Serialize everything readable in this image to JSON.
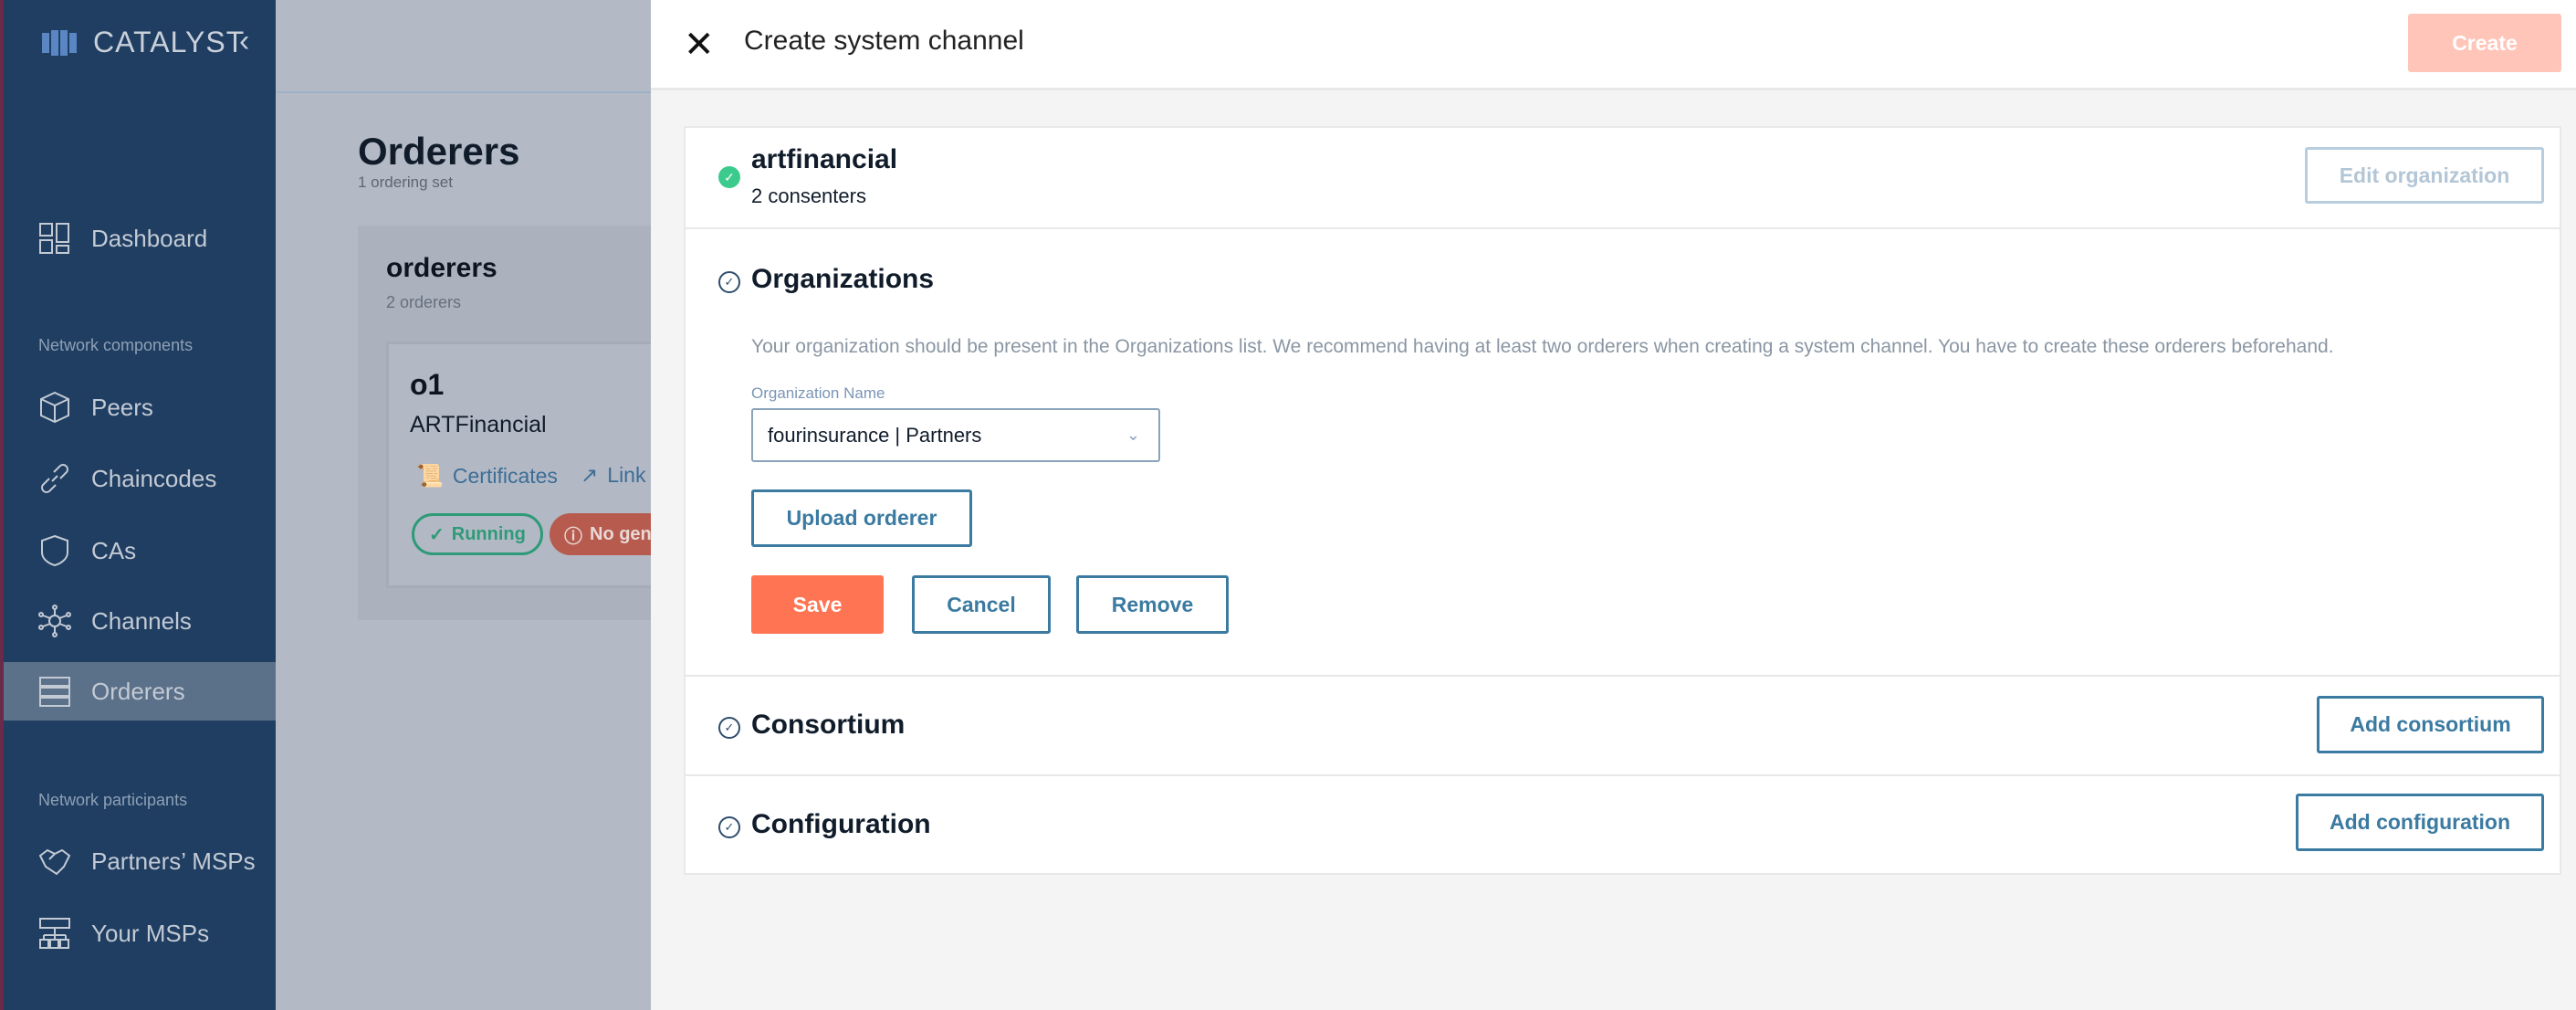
{
  "sidebar": {
    "logo": "CATALYST",
    "sections": [
      {
        "label": "Network components"
      },
      {
        "label": "Network participants"
      }
    ],
    "items": [
      {
        "label": "Dashboard",
        "icon": "dashboard-icon"
      },
      {
        "label": "Peers",
        "icon": "cube-icon"
      },
      {
        "label": "Chaincodes",
        "icon": "link-icon"
      },
      {
        "label": "CAs",
        "icon": "shield-icon"
      },
      {
        "label": "Channels",
        "icon": "network-icon"
      },
      {
        "label": "Orderers",
        "icon": "server-icon",
        "active": true
      },
      {
        "label": "Partners’ MSPs",
        "icon": "handshake-icon"
      },
      {
        "label": "Your MSPs",
        "icon": "hierarchy-icon"
      }
    ]
  },
  "page": {
    "title": "Orderers",
    "subtitle": "1 ordering set",
    "set": {
      "name": "orderers",
      "count": "2 orderers",
      "orderer": {
        "name": "o1",
        "org": "ARTFinancial",
        "certificates": "Certificates",
        "link": "Link",
        "status": "Running",
        "warning": "No gen"
      }
    }
  },
  "modal": {
    "title": "Create system channel",
    "create_label": "Create",
    "org": {
      "name": "artfinancial",
      "consenters": "2 consenters",
      "edit_label": "Edit organization"
    },
    "organizations": {
      "title": "Organizations",
      "description": "Your organization should be present in the Organizations list. We recommend having at least two orderers when creating a system channel. You have to create these orderers beforehand.",
      "field_label": "Organization Name",
      "field_value": "fourinsurance | Partners",
      "upload_label": "Upload orderer",
      "save_label": "Save",
      "cancel_label": "Cancel",
      "remove_label": "Remove"
    },
    "consortium": {
      "title": "Consortium",
      "add_label": "Add consortium"
    },
    "configuration": {
      "title": "Configuration",
      "add_label": "Add configuration"
    }
  },
  "colors": {
    "accent": "#ff7452",
    "primary": "#3b7aa1",
    "success": "#3ccb8c",
    "sidebar": "#1f3e62"
  }
}
